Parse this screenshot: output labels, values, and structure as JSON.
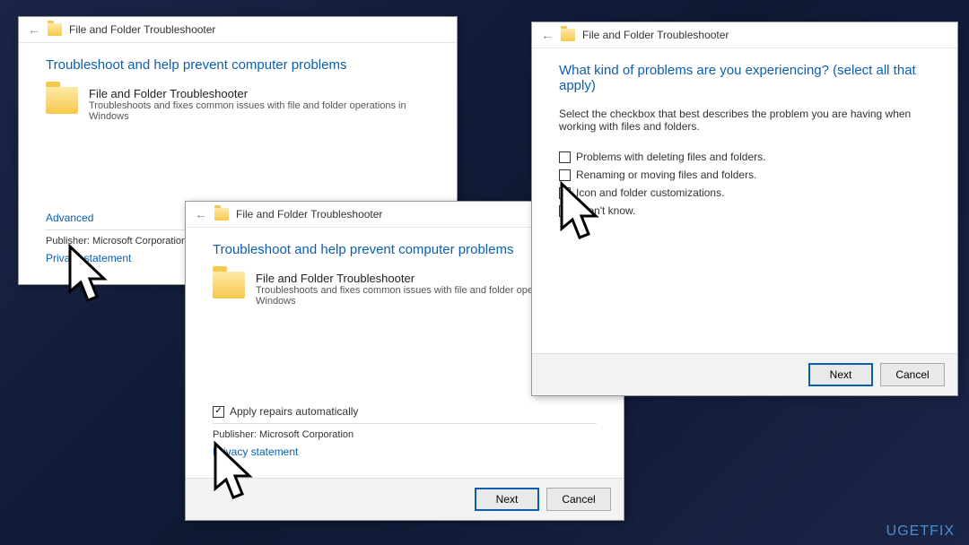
{
  "app_title": "File and Folder Troubleshooter",
  "window1": {
    "heading": "Troubleshoot and help prevent computer problems",
    "item_title": "File and Folder Troubleshooter",
    "item_desc": "Troubleshoots and fixes common issues with file and folder operations in Windows",
    "advanced": "Advanced",
    "publisher_label": "Publisher:",
    "publisher_value": "Microsoft Corporation",
    "privacy": "Privacy statement"
  },
  "window2": {
    "heading": "Troubleshoot and help prevent computer problems",
    "item_title": "File and Folder Troubleshooter",
    "item_desc": "Troubleshoots and fixes common issues with file and folder operations in Windows",
    "apply_label": "Apply repairs automatically",
    "publisher_label": "Publisher:",
    "publisher_value": "Microsoft Corporation",
    "privacy": "Privacy statement",
    "next": "Next",
    "cancel": "Cancel"
  },
  "window3": {
    "heading": "What kind of problems are you experiencing? (select all that apply)",
    "instruction": "Select the checkbox that best describes the problem you are having when working with files and folders.",
    "options": {
      "o1": "Problems with deleting files and folders.",
      "o2": "Renaming or moving files and folders.",
      "o3": "Icon and folder customizations.",
      "o4": "I don't know."
    },
    "next": "Next",
    "cancel": "Cancel"
  },
  "watermark": "UGETFIX"
}
